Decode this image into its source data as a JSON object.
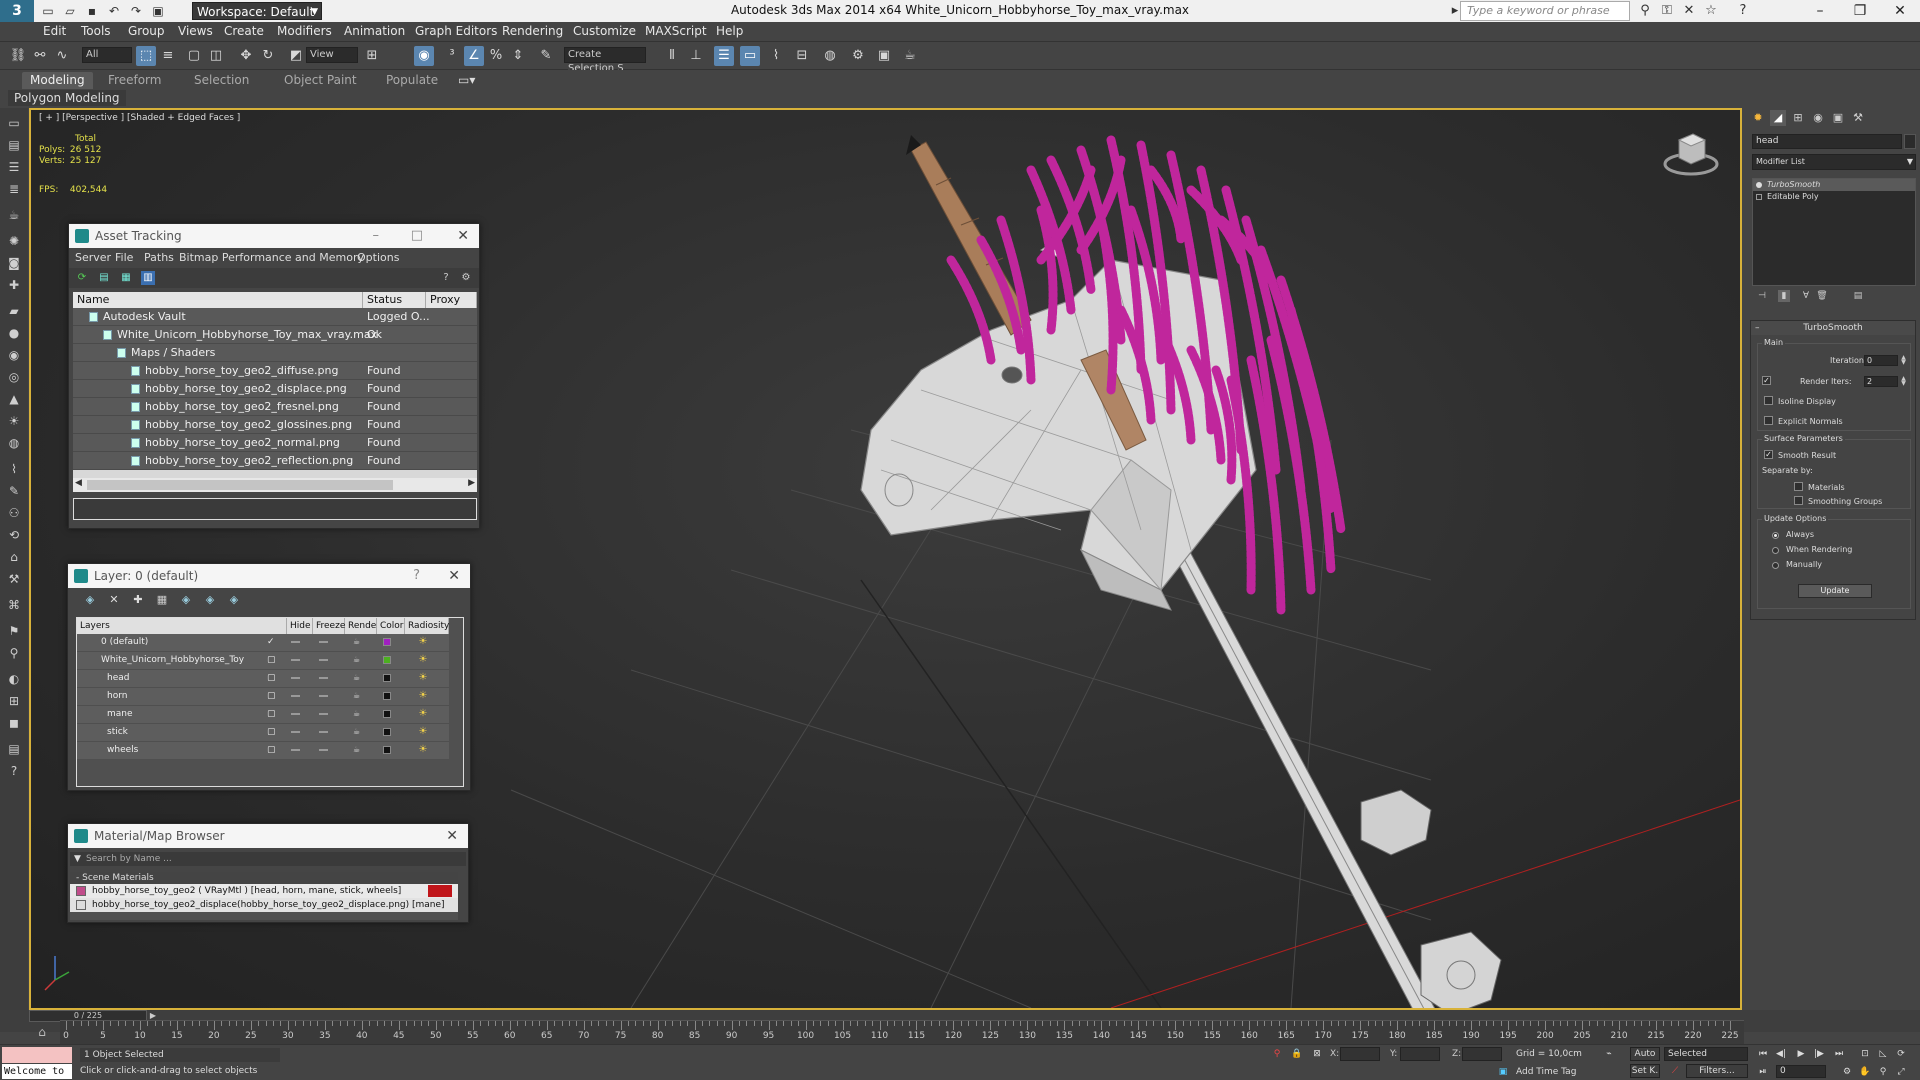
{
  "app": {
    "title": "Autodesk 3ds Max  2014 x64     White_Unicorn_Hobbyhorse_Toy_max_vray.max",
    "workspace_label": "Workspace: Default",
    "search_placeholder": "Type a keyword or phrase",
    "logo_letter": "3"
  },
  "menus": [
    "Edit",
    "Tools",
    "Group",
    "Views",
    "Create",
    "Modifiers",
    "Animation",
    "Graph Editors",
    "Rendering",
    "Customize",
    "MAXScript",
    "Help"
  ],
  "toolbar": {
    "filter_value": "All",
    "refcoord_value": "View",
    "named_selection_value": "Create Selection S"
  },
  "ribbon": {
    "tabs": [
      "Modeling",
      "Freeform",
      "Selection",
      "Object Paint",
      "Populate"
    ],
    "active_tab": "Modeling",
    "sub_label": "Polygon Modeling"
  },
  "viewport": {
    "label": "[ + ] [Perspective ] [Shaded + Edged Faces ]",
    "stats_total": "Total",
    "polys_label": "Polys:",
    "polys_value": "26 512",
    "verts_label": "Verts:",
    "verts_value": "25 127",
    "fps_label": "FPS:",
    "fps_value": "402,544"
  },
  "asset_tracking": {
    "title": "Asset Tracking",
    "menus": [
      "Server",
      "File",
      "Paths",
      "Bitmap Performance and Memory",
      "Options"
    ],
    "columns": [
      "Name",
      "Status",
      "Proxy Res"
    ],
    "rows": [
      {
        "name": "Autodesk Vault",
        "status": "Logged O...",
        "indent": 0
      },
      {
        "name": "White_Unicorn_Hobbyhorse_Toy_max_vray.max",
        "status": "Ok",
        "indent": 1
      },
      {
        "name": "Maps / Shaders",
        "status": "",
        "indent": 2
      },
      {
        "name": "hobby_horse_toy_geo2_diffuse.png",
        "status": "Found",
        "indent": 3
      },
      {
        "name": "hobby_horse_toy_geo2_displace.png",
        "status": "Found",
        "indent": 3
      },
      {
        "name": "hobby_horse_toy_geo2_fresnel.png",
        "status": "Found",
        "indent": 3
      },
      {
        "name": "hobby_horse_toy_geo2_glossines.png",
        "status": "Found",
        "indent": 3
      },
      {
        "name": "hobby_horse_toy_geo2_normal.png",
        "status": "Found",
        "indent": 3
      },
      {
        "name": "hobby_horse_toy_geo2_reflection.png",
        "status": "Found",
        "indent": 3
      }
    ]
  },
  "layer_explorer": {
    "title": "Layer: 0 (default)",
    "help": "?",
    "columns": [
      "Layers",
      "Hide",
      "Freeze",
      "Render",
      "Color",
      "Radiosity"
    ],
    "rows": [
      {
        "name": "0 (default)",
        "indent": 0,
        "color": "#a020c0",
        "current": true
      },
      {
        "name": "White_Unicorn_Hobbyhorse_Toy",
        "indent": 0,
        "color": "#4caf20",
        "current": false
      },
      {
        "name": "head",
        "indent": 1,
        "color": "#111111",
        "current": false
      },
      {
        "name": "horn",
        "indent": 1,
        "color": "#111111",
        "current": false
      },
      {
        "name": "mane",
        "indent": 1,
        "color": "#111111",
        "current": false
      },
      {
        "name": "stick",
        "indent": 1,
        "color": "#111111",
        "current": false
      },
      {
        "name": "wheels",
        "indent": 1,
        "color": "#111111",
        "current": false
      }
    ]
  },
  "material_browser": {
    "title": "Material/Map Browser",
    "search_placeholder": "Search by Name ...",
    "section": "- Scene Materials",
    "items": [
      "hobby_horse_toy_geo2  ( VRayMtl )  [head, horn, mane, stick, wheels]",
      "hobby_horse_toy_geo2_displace(hobby_horse_toy_geo2_displace.png) [mane]"
    ]
  },
  "command_panel": {
    "object_name": "head",
    "modifier_list": "Modifier List",
    "stack": [
      "TurboSmooth",
      "Editable Poly"
    ],
    "rollout_title": "TurboSmooth",
    "main_group": "Main",
    "iterations_label": "Iterations:",
    "iterations_value": "0",
    "render_iters_label": "Render Iters:",
    "render_iters_value": "2",
    "isoline_label": "Isoline Display",
    "explicit_label": "Explicit Normals",
    "surface_group": "Surface Parameters",
    "smooth_result_label": "Smooth Result",
    "separate_by_label": "Separate by:",
    "materials_label": "Materials",
    "smoothing_groups_label": "Smoothing Groups",
    "update_group": "Update Options",
    "always_label": "Always",
    "when_rendering_label": "When Rendering",
    "manually_label": "Manually",
    "update_button": "Update"
  },
  "timeline": {
    "slider_text": "0 / 225",
    "labels": [
      "0",
      "5",
      "10",
      "15",
      "20",
      "25",
      "30",
      "35",
      "40",
      "45",
      "50",
      "55",
      "60",
      "65",
      "70",
      "75",
      "80",
      "85",
      "90",
      "95",
      "100",
      "105",
      "110",
      "115",
      "120",
      "125",
      "130",
      "135",
      "140",
      "145",
      "150",
      "155",
      "160",
      "165",
      "170",
      "175",
      "180",
      "185",
      "190",
      "195",
      "200",
      "205",
      "210",
      "215",
      "220",
      "225"
    ]
  },
  "status": {
    "maxscript_text": "Welcome to",
    "selection": "1 Object Selected",
    "prompt": "Click or click-and-drag to select objects",
    "x_label": "X:",
    "y_label": "Y:",
    "z_label": "Z:",
    "grid": "Grid = 10,0cm",
    "add_time_tag": "Add Time Tag",
    "auto_key": "Auto",
    "set_key": "Set K.",
    "selected": "Selected",
    "filters": "Filters...",
    "frame": "0"
  },
  "colors": {
    "viewport_border": "#d8b23a",
    "mane": "#c0269c",
    "stats": "#e3e04a"
  }
}
